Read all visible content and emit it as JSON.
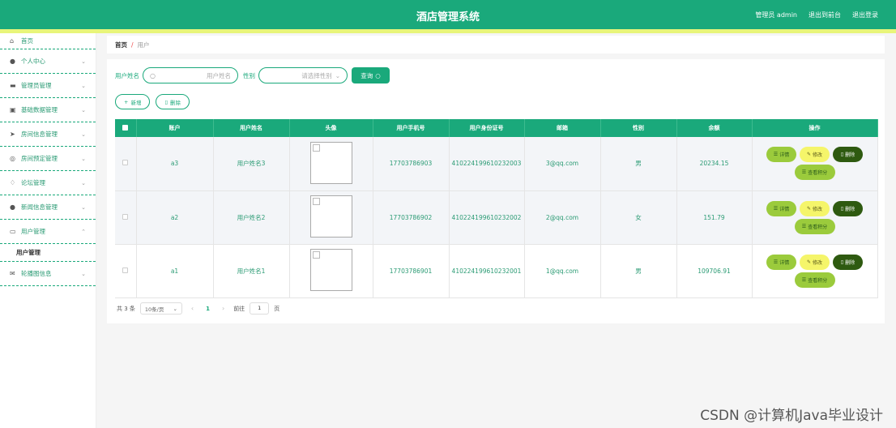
{
  "header": {
    "title": "酒店管理系统",
    "admin_label": "管理员 admin",
    "to_frontend": "退出到前台",
    "logout": "退出登录"
  },
  "sidebar": {
    "items": [
      {
        "label": "首页",
        "icon": "home-icon",
        "has_chevron": false
      },
      {
        "label": "个人中心",
        "icon": "user-icon",
        "has_chevron": true
      },
      {
        "label": "管理员管理",
        "icon": "admin-icon",
        "has_chevron": true
      },
      {
        "label": "基础数据管理",
        "icon": "data-icon",
        "has_chevron": true
      },
      {
        "label": "房间信息管理",
        "icon": "send-icon",
        "has_chevron": true
      },
      {
        "label": "房间预定管理",
        "icon": "booking-icon",
        "has_chevron": true
      },
      {
        "label": "论坛管理",
        "icon": "forum-icon",
        "has_chevron": true
      },
      {
        "label": "新闻信息管理",
        "icon": "news-icon",
        "has_chevron": true
      },
      {
        "label": "用户管理",
        "icon": "users-icon",
        "has_chevron": true,
        "expanded": true
      },
      {
        "label": "轮播图信息",
        "icon": "mail-icon",
        "has_chevron": true
      }
    ],
    "sub_item": "用户管理"
  },
  "breadcrumb": {
    "home": "首页",
    "separator": "/",
    "current": "用户"
  },
  "search": {
    "name_label": "用户姓名",
    "name_placeholder": "用户姓名",
    "gender_label": "性别",
    "gender_placeholder": "请选择性别",
    "query_button": "查询"
  },
  "actions": {
    "add": "新增",
    "delete": "删除"
  },
  "table": {
    "columns": [
      "账户",
      "用户姓名",
      "头像",
      "用户手机号",
      "用户身份证号",
      "邮箱",
      "性别",
      "余额",
      "操作"
    ],
    "rows": [
      {
        "account": "a3",
        "name": "用户姓名3",
        "phone": "17703786903",
        "id_card": "410224199610232003",
        "email": "3@qq.com",
        "gender": "男",
        "balance": "20234.15"
      },
      {
        "account": "a2",
        "name": "用户姓名2",
        "phone": "17703786902",
        "id_card": "410224199610232002",
        "email": "2@qq.com",
        "gender": "女",
        "balance": "151.79"
      },
      {
        "account": "a1",
        "name": "用户姓名1",
        "phone": "17703786901",
        "id_card": "410224199610232001",
        "email": "1@qq.com",
        "gender": "男",
        "balance": "109706.91"
      }
    ],
    "op_labels": {
      "detail": "详情",
      "edit": "修改",
      "delete": "删除",
      "view_score": "查看积分"
    }
  },
  "pagination": {
    "total": "共 3 条",
    "page_size": "10条/页",
    "current_page": "1",
    "goto_label": "前往",
    "goto_value": "1",
    "page_suffix": "页"
  },
  "watermark": "CSDN @计算机Java毕业设计",
  "colors": {
    "primary": "#1aa97b",
    "stripe": "#e8f57a",
    "detail": "#9bcb3c",
    "edit": "#f5f56a",
    "delete": "#2e5a10"
  }
}
